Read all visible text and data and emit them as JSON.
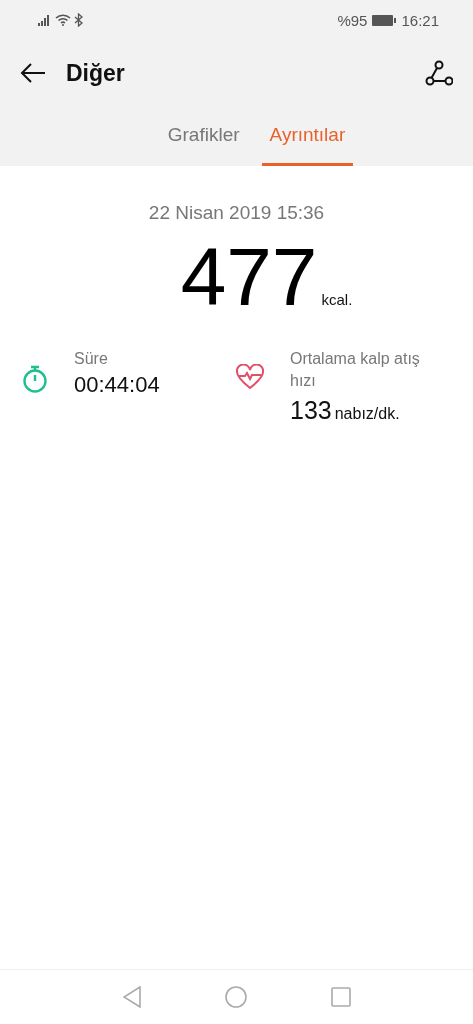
{
  "status_bar": {
    "battery_text": "%95",
    "time": "16:21"
  },
  "header": {
    "title": "Diğer"
  },
  "tabs": [
    {
      "label": "Grafikler",
      "selected": false
    },
    {
      "label": "Ayrıntılar",
      "selected": true
    }
  ],
  "summary": {
    "datetime": "22 Nisan 2019 15:36",
    "calories": "477",
    "calories_unit": "kcal."
  },
  "stats": [
    {
      "kind": "timer",
      "label": "Süre",
      "value": "00:44:04"
    },
    {
      "kind": "heart",
      "label": "Ortalama kalp atış hızı",
      "value": "133",
      "unit": "nabız/dk."
    }
  ]
}
